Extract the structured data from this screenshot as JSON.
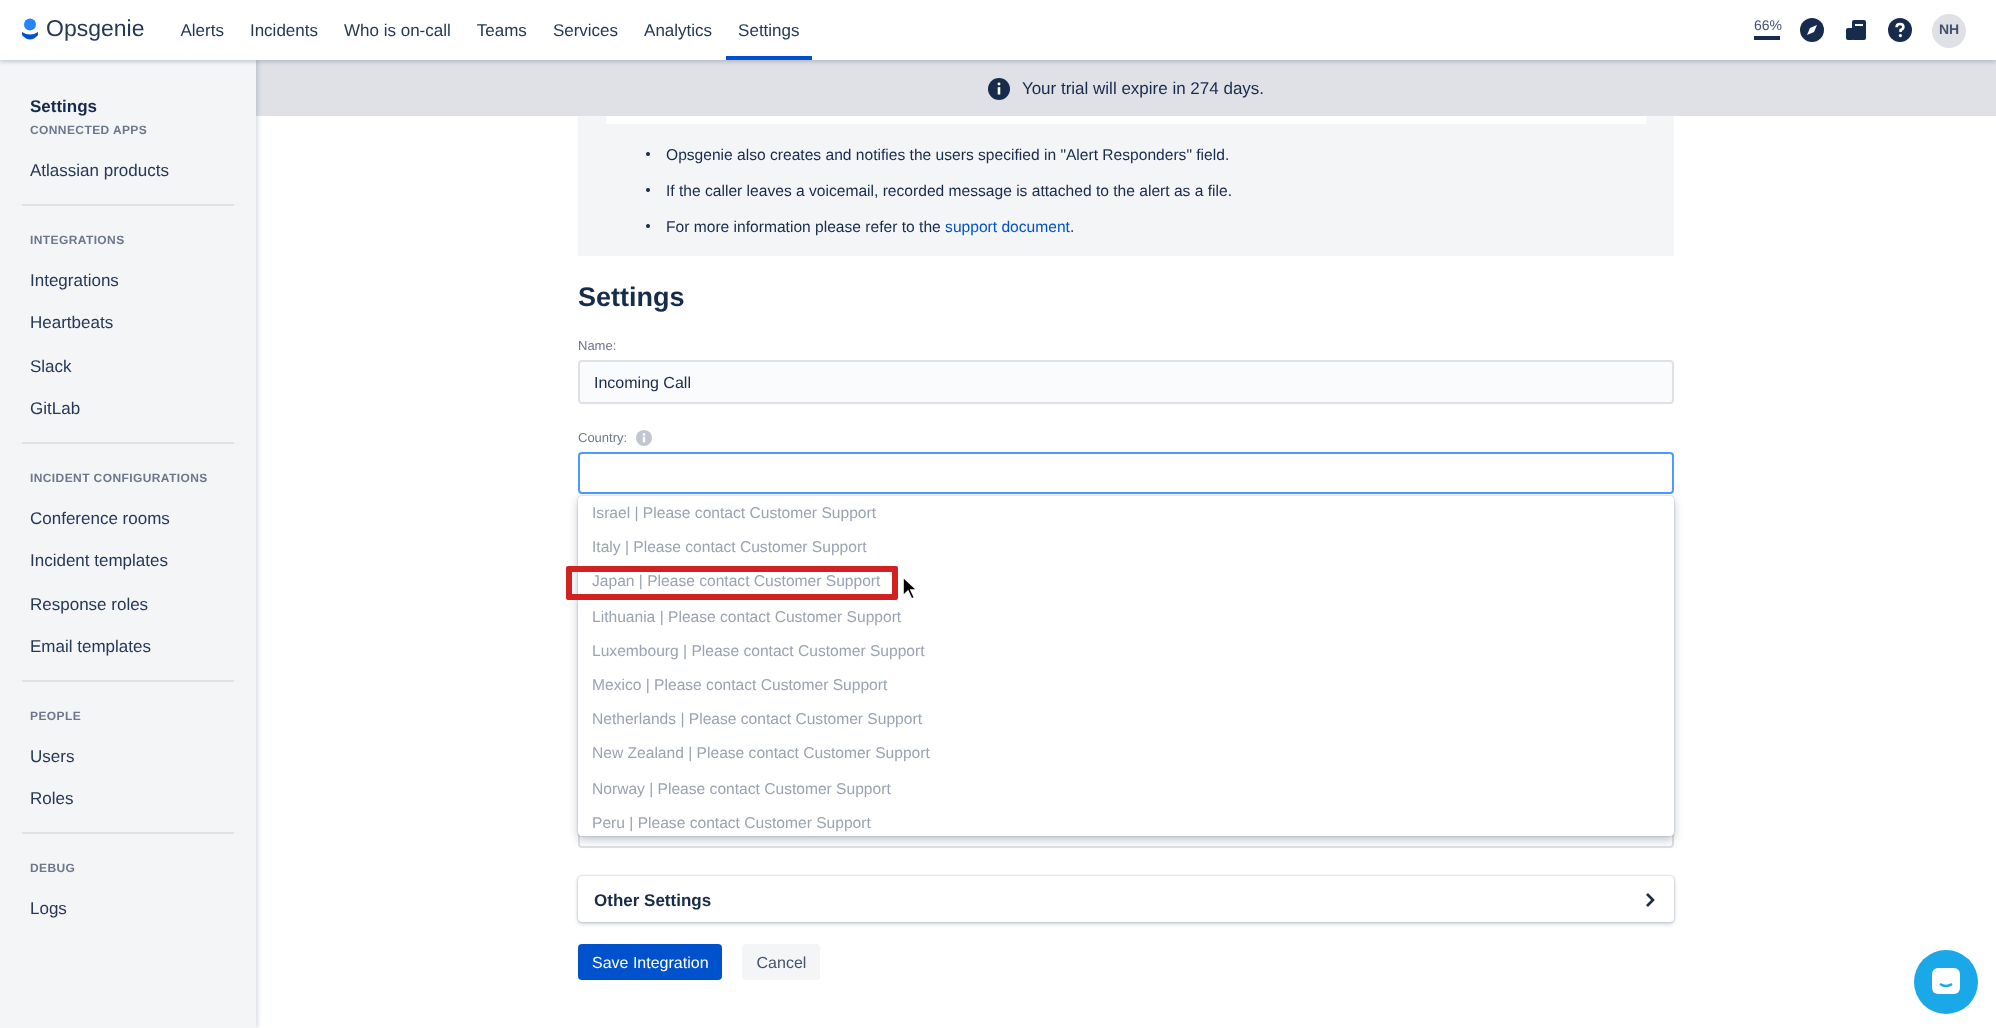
{
  "nav": {
    "logo": "Opsgenie",
    "items": [
      {
        "label": "Alerts",
        "selected": false
      },
      {
        "label": "Incidents",
        "selected": false
      },
      {
        "label": "Who is on-call",
        "selected": false
      },
      {
        "label": "Teams",
        "selected": false
      },
      {
        "label": "Services",
        "selected": false
      },
      {
        "label": "Analytics",
        "selected": false
      },
      {
        "label": "Settings",
        "selected": true
      }
    ],
    "zoom": "66%",
    "avatar": "NH"
  },
  "sidebar": {
    "title": "Settings",
    "sections": [
      {
        "heading": "CONNECTED APPS",
        "items": [
          {
            "label": "Atlassian products"
          }
        ]
      },
      {
        "heading": "INTEGRATIONS",
        "items": [
          {
            "label": "Integrations"
          },
          {
            "label": "Heartbeats"
          },
          {
            "label": "Slack"
          },
          {
            "label": "GitLab"
          }
        ]
      },
      {
        "heading": "INCIDENT CONFIGURATIONS",
        "items": [
          {
            "label": "Conference rooms"
          },
          {
            "label": "Incident templates"
          },
          {
            "label": "Response roles"
          },
          {
            "label": "Email templates"
          }
        ]
      },
      {
        "heading": "PEOPLE",
        "items": [
          {
            "label": "Users"
          },
          {
            "label": "Roles"
          }
        ]
      },
      {
        "heading": "DEBUG",
        "items": [
          {
            "label": "Logs"
          }
        ]
      }
    ]
  },
  "banner": {
    "text": "Your trial will expire in 274 days."
  },
  "info": {
    "bullets": [
      {
        "text": "Opsgenie also creates and notifies the users specified in \"Alert Responders\" field."
      },
      {
        "text": "If the caller leaves a voicemail, recorded message is attached to the alert as a file."
      },
      {
        "text": "For more information please refer to the ",
        "link": "support document",
        "suffix": "."
      }
    ]
  },
  "form": {
    "heading": "Settings",
    "name": {
      "label": "Name:",
      "value": "Incoming Call"
    },
    "country": {
      "label": "Country:",
      "focused": true,
      "options": [
        {
          "label": "Israel | Please contact Customer Support",
          "disabled": true,
          "highlighted": false
        },
        {
          "label": "Italy | Please contact Customer Support",
          "disabled": true,
          "highlighted": false
        },
        {
          "label": "Japan | Please contact Customer Support",
          "disabled": true,
          "highlighted": true
        },
        {
          "label": "Lithuania | Please contact Customer Support",
          "disabled": true,
          "highlighted": false
        },
        {
          "label": "Luxembourg | Please contact Customer Support",
          "disabled": true,
          "highlighted": false
        },
        {
          "label": "Mexico | Please contact Customer Support",
          "disabled": true,
          "highlighted": false
        },
        {
          "label": "Netherlands | Please contact Customer Support",
          "disabled": true,
          "highlighted": false
        },
        {
          "label": "New Zealand | Please contact Customer Support",
          "disabled": true,
          "highlighted": false
        },
        {
          "label": "Norway | Please contact Customer Support",
          "disabled": true,
          "highlighted": false
        },
        {
          "label": "Peru | Please contact Customer Support",
          "disabled": true,
          "highlighted": false
        }
      ]
    },
    "other_settings": {
      "label": "Other Settings",
      "expanded": false
    },
    "buttons": [
      {
        "label": "Save Integration",
        "kind": "primary"
      },
      {
        "label": "Cancel",
        "kind": "secondary"
      }
    ]
  }
}
